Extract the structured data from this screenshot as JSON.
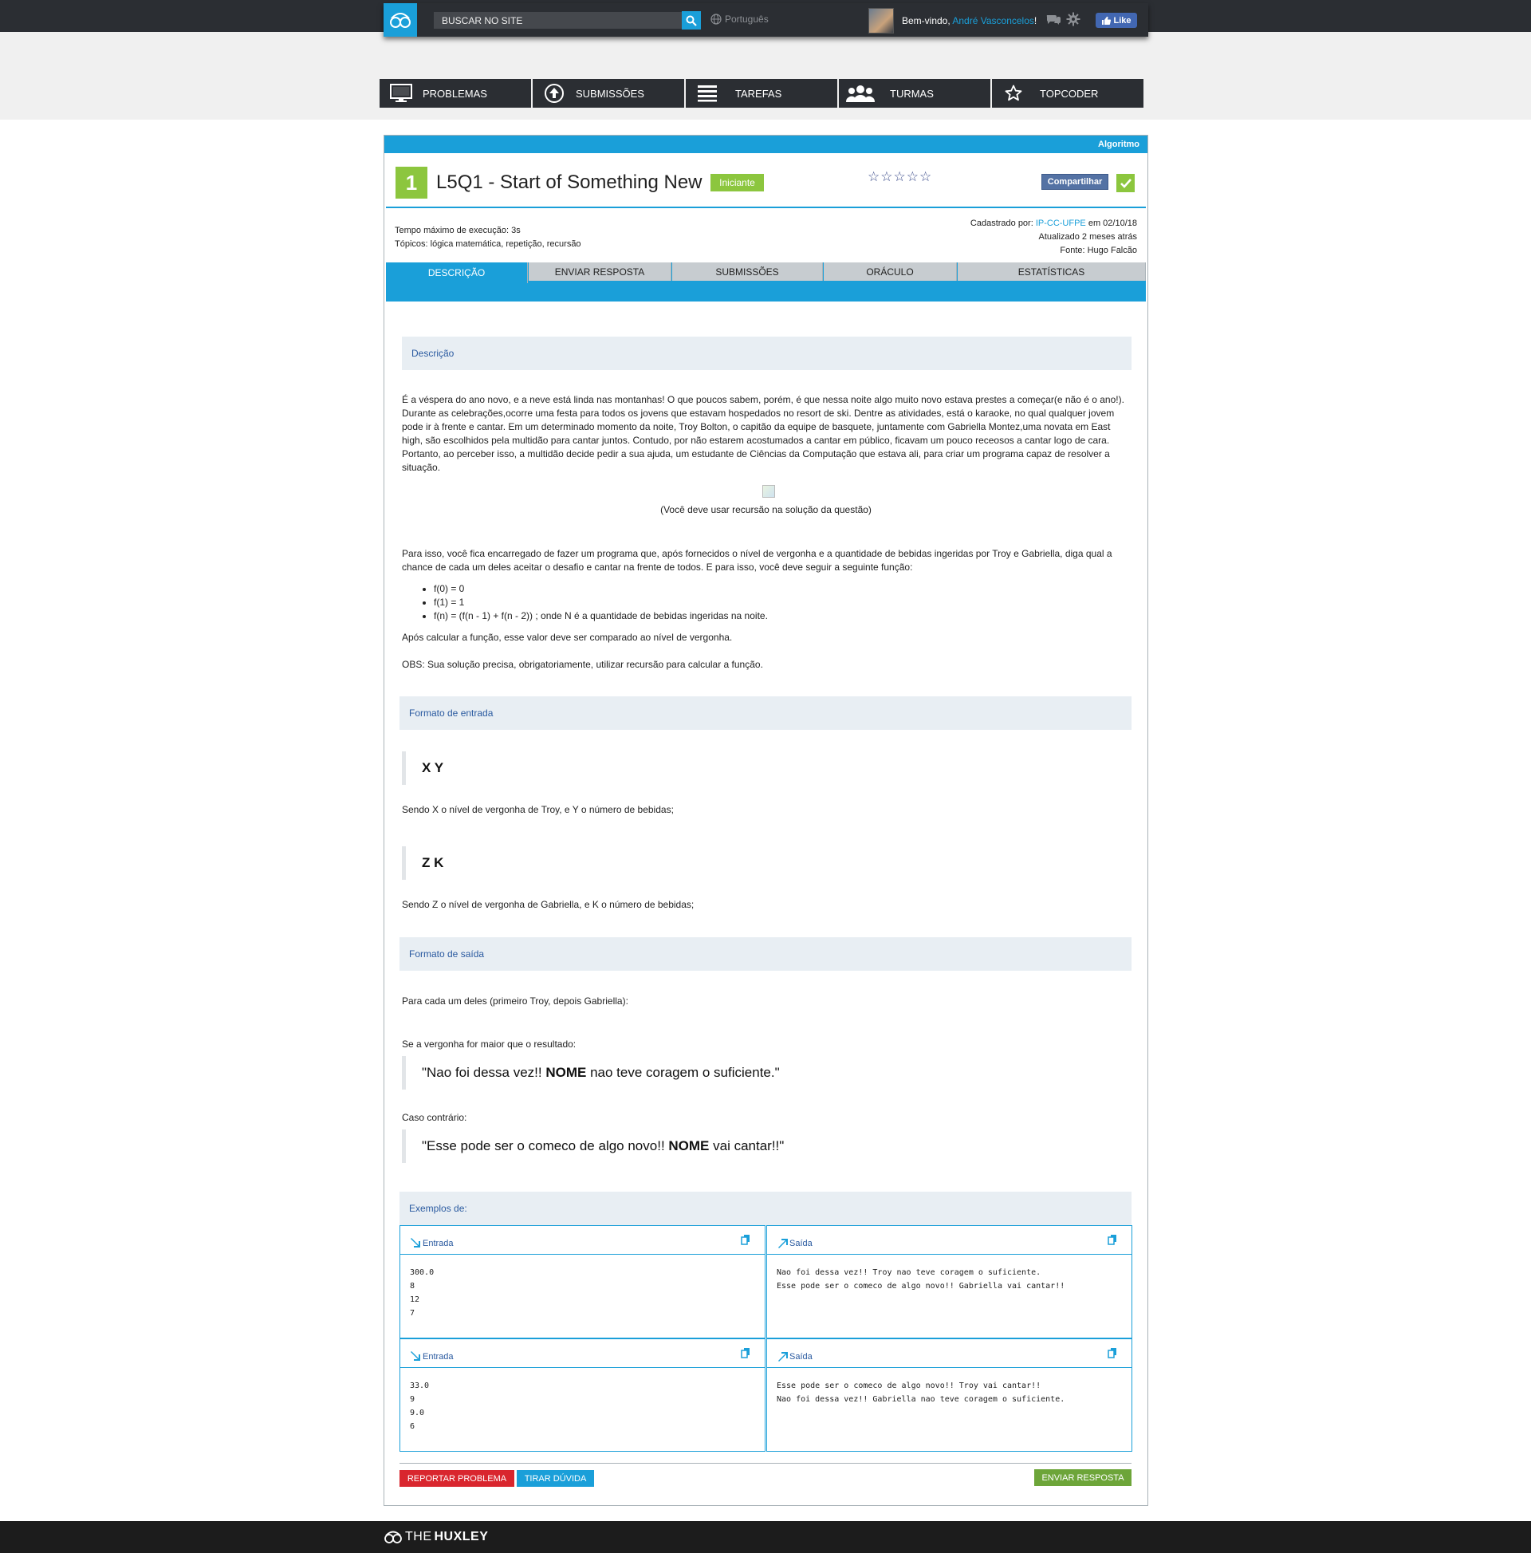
{
  "header": {
    "search_placeholder": "BUSCAR NO SITE",
    "language": "Português",
    "welcome_prefix": "Bem-vindo, ",
    "user_name": "André Vasconcelos",
    "welcome_suffix": "!",
    "like_label": "Like"
  },
  "nav": {
    "items": [
      {
        "label": "PROBLEMAS",
        "icon": "monitor-icon"
      },
      {
        "label": "SUBMISSÕES",
        "icon": "upload-icon"
      },
      {
        "label": "TAREFAS",
        "icon": "list-icon"
      },
      {
        "label": "TURMAS",
        "icon": "users-icon"
      },
      {
        "label": "TOPCODER",
        "icon": "star-icon"
      }
    ]
  },
  "problem": {
    "category": "Algoritmo",
    "number": "1",
    "title": "L5Q1 - Start of Something New",
    "level": "Iniciante",
    "stars": "☆☆☆☆☆",
    "share_label": "Compartilhar",
    "exec_time": "Tempo máximo de execução: 3s",
    "topics": "Tópicos: lógica matemática, repetição, recursão",
    "registered_prefix": "Cadastrado por: ",
    "registered_by": "IP-CC-UFPE",
    "registered_suffix": " em 02/10/18",
    "updated": "Atualizado 2 meses atrás",
    "source": "Fonte: Hugo Falcão"
  },
  "tabs": [
    "DESCRIÇÃO",
    "ENVIAR RESPOSTA",
    "SUBMISSÕES",
    "ORÁCULO",
    "ESTATÍSTICAS"
  ],
  "description": {
    "heading": "Descrição",
    "intro": "É a véspera do ano novo, e a neve está linda nas montanhas! O que poucos sabem, porém, é que nessa noite algo muito novo estava prestes a começar(e não é o ano!). Durante as celebrações,ocorre uma festa para todos os jovens que estavam hospedados no resort de ski. Dentre as atividades, está o karaoke, no qual qualquer jovem pode ir à frente e cantar. Em um determinado momento da noite, Troy Bolton, o capitão da equipe de basquete, juntamente com Gabriella Montez,uma novata em East high, são escolhidos pela multidão para cantar juntos. Contudo, por não estarem acostumados a cantar em público, ficavam um pouco receosos a cantar logo de cara. Portanto, ao perceber isso, a multidão decide pedir a sua ajuda, um estudante de Ciências da Computação que estava ali, para criar um programa capaz de resolver a situação.",
    "image_caption": "(Você deve usar recursão na solução da questão)",
    "task": "Para isso, você fica encarregado de fazer um programa que, após fornecidos o nível de vergonha e a quantidade de bebidas ingeridas por Troy e Gabriella, diga qual a chance de cada um deles aceitar o desafio e cantar na frente de todos. E para isso, você deve seguir a seguinte função:",
    "formulas": [
      "f(0) = 0",
      "f(1) = 1",
      "f(n) = (f(n - 1) + f(n - 2)) ; onde N é a quantidade de bebidas ingeridas na noite."
    ],
    "after": "Após calcular a função, esse valor deve ser comparado ao nível de vergonha.",
    "obs": "OBS: Sua solução precisa, obrigatoriamente, utilizar recursão para calcular a função."
  },
  "input_format": {
    "heading": "Formato de entrada",
    "line1": "X Y",
    "line1_desc": "Sendo X o nível de vergonha de Troy, e Y o número de bebidas;",
    "line2": "Z K",
    "line2_desc": "Sendo Z o nível de vergonha de Gabriella, e K o número de bebidas;"
  },
  "output_format": {
    "heading": "Formato de saída",
    "intro": "Para cada um deles (primeiro Troy, depois Gabriella):",
    "case1": "Se a vergonha for maior que o resultado:",
    "quote1_a": "\"Nao foi dessa vez!! ",
    "quote1_b": "NOME",
    "quote1_c": " nao teve coragem o suficiente.\"",
    "case2": "Caso contrário:",
    "quote2_a": "\"Esse pode ser o comeco de algo novo!! ",
    "quote2_b": "NOME",
    "quote2_c": " vai cantar!!\""
  },
  "examples": {
    "heading": "Exemplos de:",
    "input_label": "Entrada",
    "output_label": "Saída",
    "items": [
      {
        "input": "300.0\n8\n12\n7",
        "output": "Nao foi dessa vez!! Troy nao teve coragem o suficiente.\nEsse pode ser o comeco de algo novo!! Gabriella vai cantar!!"
      },
      {
        "input": "33.0\n9\n9.0\n6",
        "output": "Esse pode ser o comeco de algo novo!! Troy vai cantar!!\nNao foi dessa vez!! Gabriella nao teve coragem o suficiente."
      }
    ]
  },
  "actions": {
    "report": "REPORTAR PROBLEMA",
    "doubt": "TIRAR DÚVIDA",
    "submit": "ENVIAR RESPOSTA"
  },
  "colors": {
    "accent": "#1a9fd9",
    "success": "#8cc63e",
    "danger": "#d9262e",
    "dark": "#2b2e33"
  },
  "footer": {
    "brand_light": "THE",
    "brand_bold": "HUXLEY"
  }
}
